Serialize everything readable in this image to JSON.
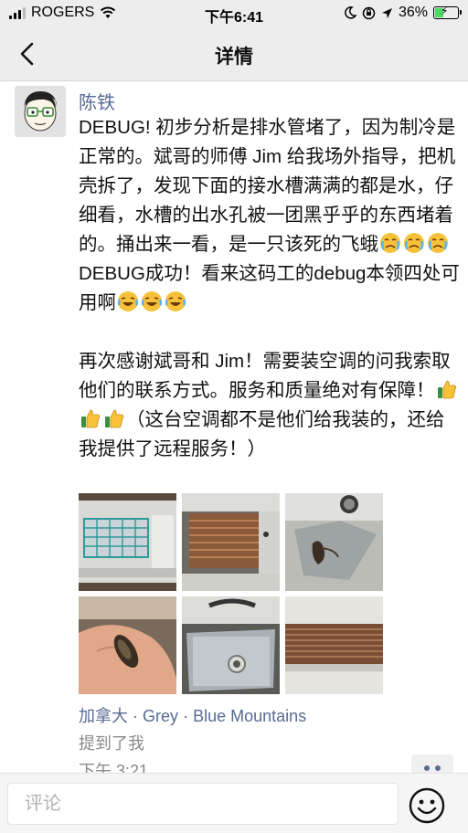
{
  "status_bar": {
    "carrier": "ROGERS",
    "time": "下午6:41",
    "battery_percent": "36%",
    "battery_level": 0.36,
    "icons": [
      "signal-icon",
      "wifi-icon",
      "moon-icon",
      "orientation-lock-icon",
      "location-arrow-icon",
      "battery-icon"
    ]
  },
  "nav": {
    "title": "详情",
    "back_icon": "chevron-left-icon"
  },
  "post": {
    "author": "陈铁",
    "paragraph1_part1": "DEBUG! 初步分析是排水管堵了，因为制冷是正常的。斌哥的师傅 Jim 给我场外指导，把机壳拆了，发现下面的接水槽满满的都是水，仔细看，水槽的出水孔被一团黑乎乎的东西堵着的。捅出来一看，是一只该死的飞蛾",
    "paragraph1_part2": "DEBUG成功！看来这码工的debug本领四处可用啊",
    "paragraph2_part1": "再次感谢斌哥和 Jim！需要装空调的问我索取他们的联系方式。服务和质量绝对有保障！",
    "paragraph2_part2": "（这台空调都不是他们给我装的，还给我提供了远程服务！）",
    "emoji_names": [
      "crying-face-emoji",
      "laughing-tears-emoji",
      "thumbs-up-emoji"
    ],
    "photos": [
      "air-conditioner-filter-photo",
      "air-conditioner-coil-photo",
      "drain-hole-photo",
      "moth-in-hand-photo",
      "water-tray-photo",
      "coil-unit-photo"
    ],
    "location": {
      "country": "加拿大",
      "name": "Grey",
      "place": "Blue Mountains",
      "separator": "·"
    },
    "mentioned": "提到了我",
    "time": "下午 3:21"
  },
  "comment": {
    "placeholder": "评论",
    "emoji_button_icon": "smiley-icon"
  },
  "colors": {
    "link_blue": "#576b95",
    "bar_gray": "#ededed",
    "battery_green": "#4cd964"
  }
}
